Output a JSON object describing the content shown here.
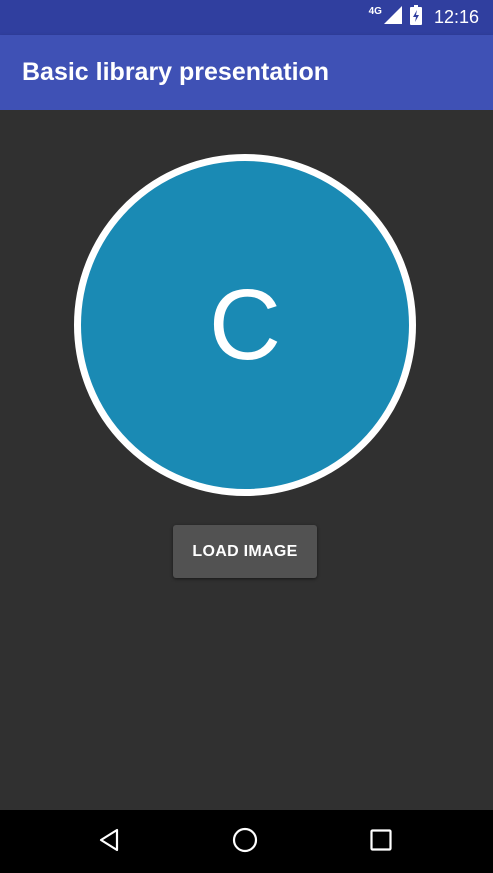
{
  "status_bar": {
    "network": "4G",
    "time": "12:16",
    "icons": [
      "signal-icon",
      "battery-icon"
    ]
  },
  "app_bar": {
    "title": "Basic library presentation"
  },
  "avatar": {
    "letter": "C",
    "fill_color": "#1a8ab4",
    "border_color": "#ffffff"
  },
  "actions": {
    "load_image_label": "LOAD IMAGE"
  },
  "nav_bar": {
    "icons": [
      "back-icon",
      "home-icon",
      "recents-icon"
    ]
  },
  "colors": {
    "status_bar": "#303f9f",
    "app_bar": "#3f51b5",
    "background": "#303030",
    "button": "#525252"
  }
}
